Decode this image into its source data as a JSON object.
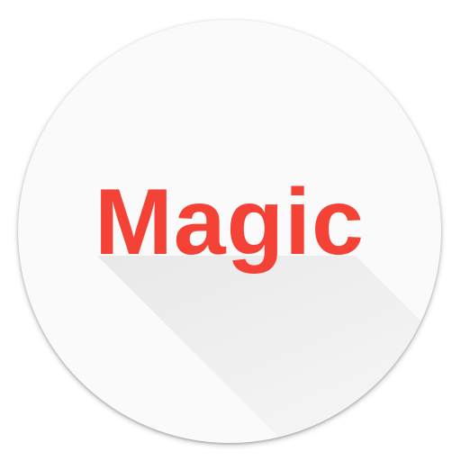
{
  "logo": {
    "text": "Magic",
    "text_color": "#f44336",
    "background_color": "#fafafa"
  }
}
